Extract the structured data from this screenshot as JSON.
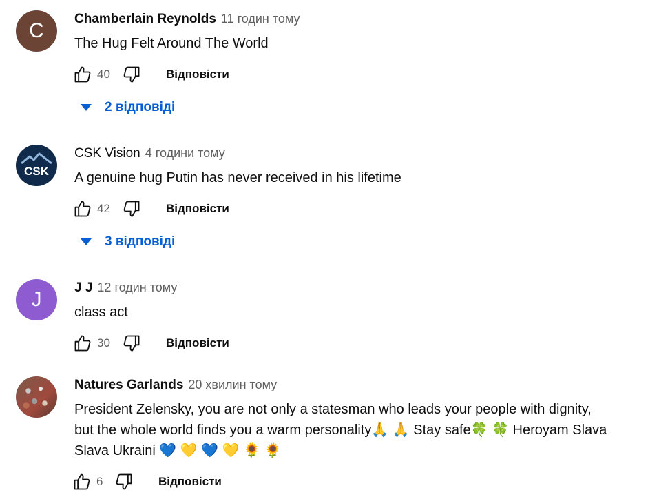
{
  "labels": {
    "reply": "Відповісти"
  },
  "colors": {
    "link": "#065fd4",
    "meta": "#606060",
    "text": "#0f0f0f"
  },
  "comments": [
    {
      "author": "Chamberlain Reynolds",
      "time": "11 годин тому",
      "avatar_letter": "C",
      "text": "The Hug Felt Around The World",
      "likes": "40",
      "replies_label": "2 відповіді"
    },
    {
      "author": "CSK Vision",
      "time": "4 години тому",
      "avatar_text": "CSK",
      "text": "A genuine hug Putin has never received in his lifetime",
      "likes": "42",
      "replies_label": "3 відповіді"
    },
    {
      "author": "J J",
      "time": "12 годин тому",
      "avatar_letter": "J",
      "text": "class act",
      "likes": "30"
    },
    {
      "author": "Natures Garlands",
      "time": "20 хвилин тому",
      "text_lines": [
        "President Zelensky, you are not only a statesman who leads your people with dignity,",
        "but the whole world finds you a warm personality🙏 🙏 Stay safe🍀 🍀 Heroyam Slava",
        "Slava Ukraini 💙 💛 💙 💛 🌻 🌻"
      ],
      "likes": "6"
    }
  ]
}
